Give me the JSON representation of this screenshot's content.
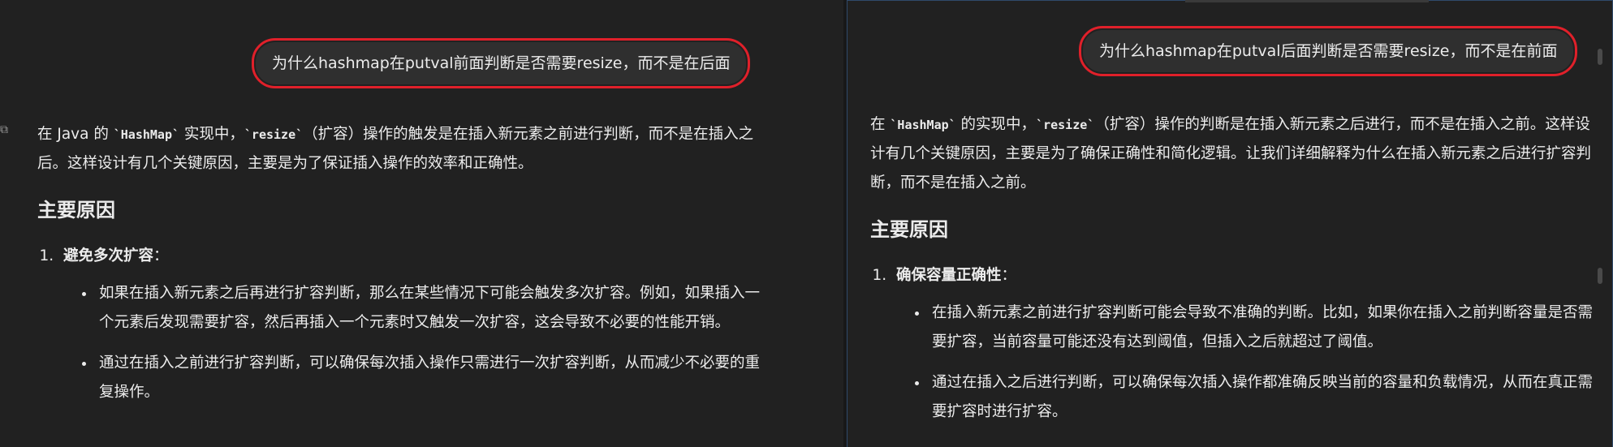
{
  "left": {
    "user_message": "为什么hashmap在putval前面判断是否需要resize，而不是在后面",
    "intro_pre": "在 Java 的 ",
    "intro_code1": "`HashMap`",
    "intro_mid": " 实现中，",
    "intro_code2": "`resize`",
    "intro_post": "（扩容）操作的触发是在插入新元素之前进行判断，而不是在插入之后。这样设计有几个关键原因，主要是为了保证插入操作的效率和正确性。",
    "section_title": "主要原因",
    "reason1_title": "避免多次扩容",
    "reason1_colon": "：",
    "bullets": [
      "如果在插入新元素之后再进行扩容判断，那么在某些情况下可能会触发多次扩容。例如，如果插入一个元素后发现需要扩容，然后再插入一个元素时又触发一次扩容，这会导致不必要的性能开销。",
      "通过在插入之前进行扩容判断，可以确保每次插入操作只需进行一次扩容判断，从而减少不必要的重复操作。"
    ]
  },
  "right": {
    "user_message": "为什么hashmap在putval后面判断是否需要resize，而不是在前面",
    "intro_pre": "在 ",
    "intro_code1": "`HashMap`",
    "intro_mid": " 的实现中，",
    "intro_code2": "`resize`",
    "intro_post": "（扩容）操作的判断是在插入新元素之后进行，而不是在插入之前。这样设计有几个关键原因，主要是为了确保正确性和简化逻辑。让我们详细解释为什么在插入新元素之后进行扩容判断，而不是在插入之前。",
    "section_title": "主要原因",
    "reason1_title": "确保容量正确性",
    "reason1_colon": "：",
    "bullets": [
      "在插入新元素之前进行扩容判断可能会导致不准确的判断。比如，如果你在插入之前判断容量是否需要扩容，当前容量可能还没有达到阈值，但插入之后就超过了阈值。",
      "通过在插入之后进行判断，可以确保每次插入操作都准确反映当前的容量和负载情况，从而在真正需要扩容时进行扩容。"
    ]
  },
  "colors": {
    "background": "#212121",
    "bubble": "#2f2f2f",
    "highlight_border": "#e0202a",
    "text": "#ececec",
    "right_pane_border": "#2f4a6b"
  }
}
